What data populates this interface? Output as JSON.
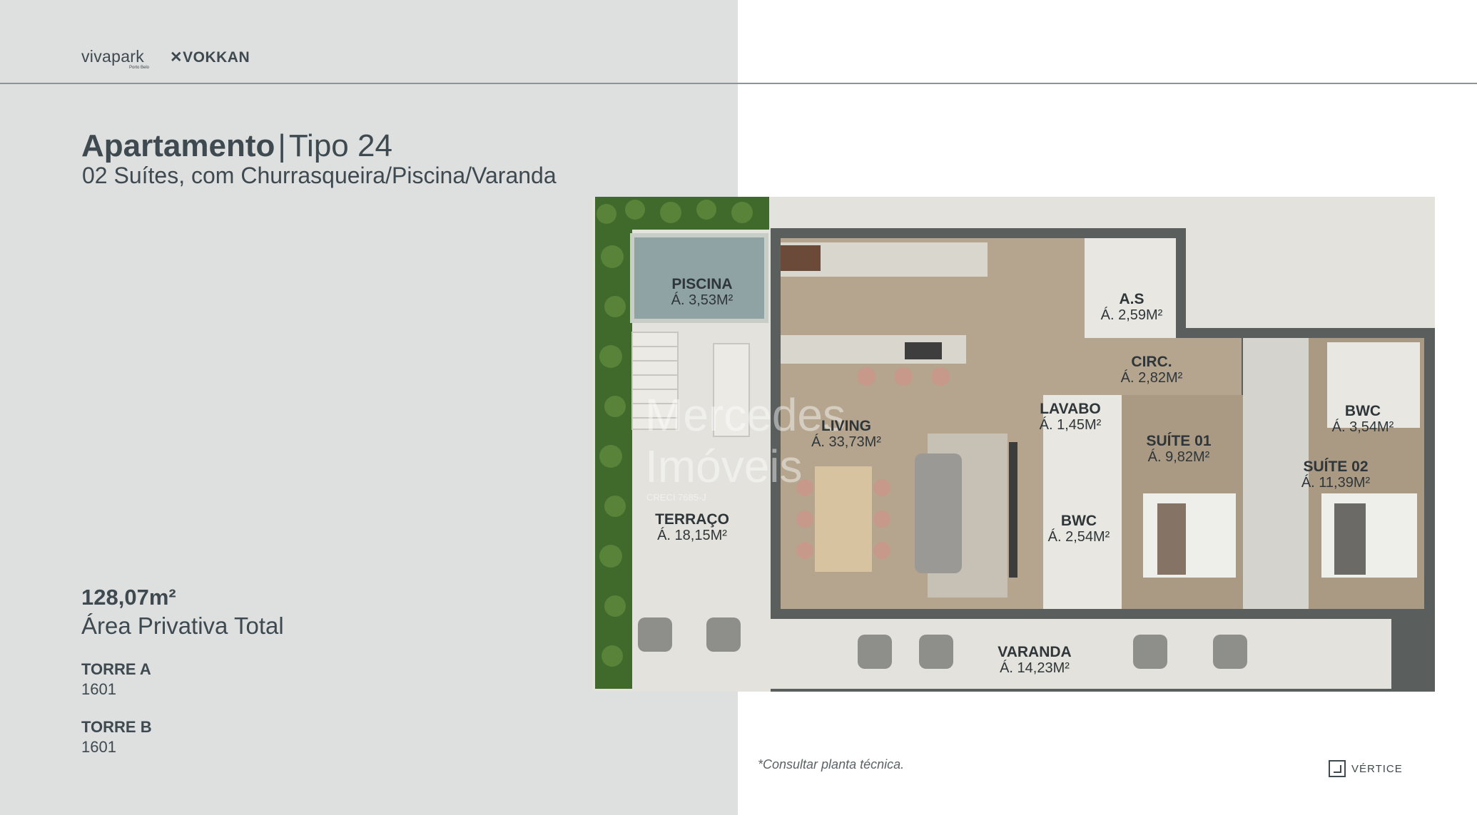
{
  "header": {
    "logo_viva": "vivapark",
    "logo_viva_sub": "Porto Belo",
    "logo_vokkan": "VOKKAN"
  },
  "title": {
    "bold": "Apartamento",
    "separator": "|",
    "type": "Tipo 24",
    "subtitle": "02 Suítes, com Churrasqueira/Piscina/Varanda"
  },
  "area": {
    "value": "128,07m²",
    "label": "Área Privativa Total"
  },
  "towers": [
    {
      "label": "TORRE A",
      "unit": "1601"
    },
    {
      "label": "TORRE B",
      "unit": "1601"
    }
  ],
  "rooms": [
    {
      "name": "PISCINA",
      "area": "Á. 3,53M²"
    },
    {
      "name": "A.S",
      "area": "Á. 2,59M²"
    },
    {
      "name": "CIRC.",
      "area": "Á. 2,82M²"
    },
    {
      "name": "LAVABO",
      "area": "Á. 1,45M²"
    },
    {
      "name": "BWC",
      "area": "Á. 3,54M²"
    },
    {
      "name": "LIVING",
      "area": "Á. 33,73M²"
    },
    {
      "name": "SUÍTE 01",
      "area": "Á. 9,82M²"
    },
    {
      "name": "SUÍTE 02",
      "area": "Á. 11,39M²"
    },
    {
      "name": "TERRAÇO",
      "area": "Á. 18,15M²"
    },
    {
      "name": "BWC",
      "area": "Á. 2,54M²"
    },
    {
      "name": "VARANDA",
      "area": "Á. 14,23M²"
    }
  ],
  "watermark": {
    "line1": "Mercedes",
    "line2": "Imóveis",
    "creci": "CRECI 7685-J"
  },
  "footer": {
    "note": "*Consultar planta técnica.",
    "brand": "VÉRTICE"
  },
  "colors": {
    "left_panel": "#dedfdf",
    "text": "#3e4a4f",
    "wall": "#5a5e5c",
    "wood_floor": "#b5a58f",
    "tile_floor": "#e3e2dc",
    "pool": "#8fa3a5",
    "greenery": "#3f6a2c"
  }
}
